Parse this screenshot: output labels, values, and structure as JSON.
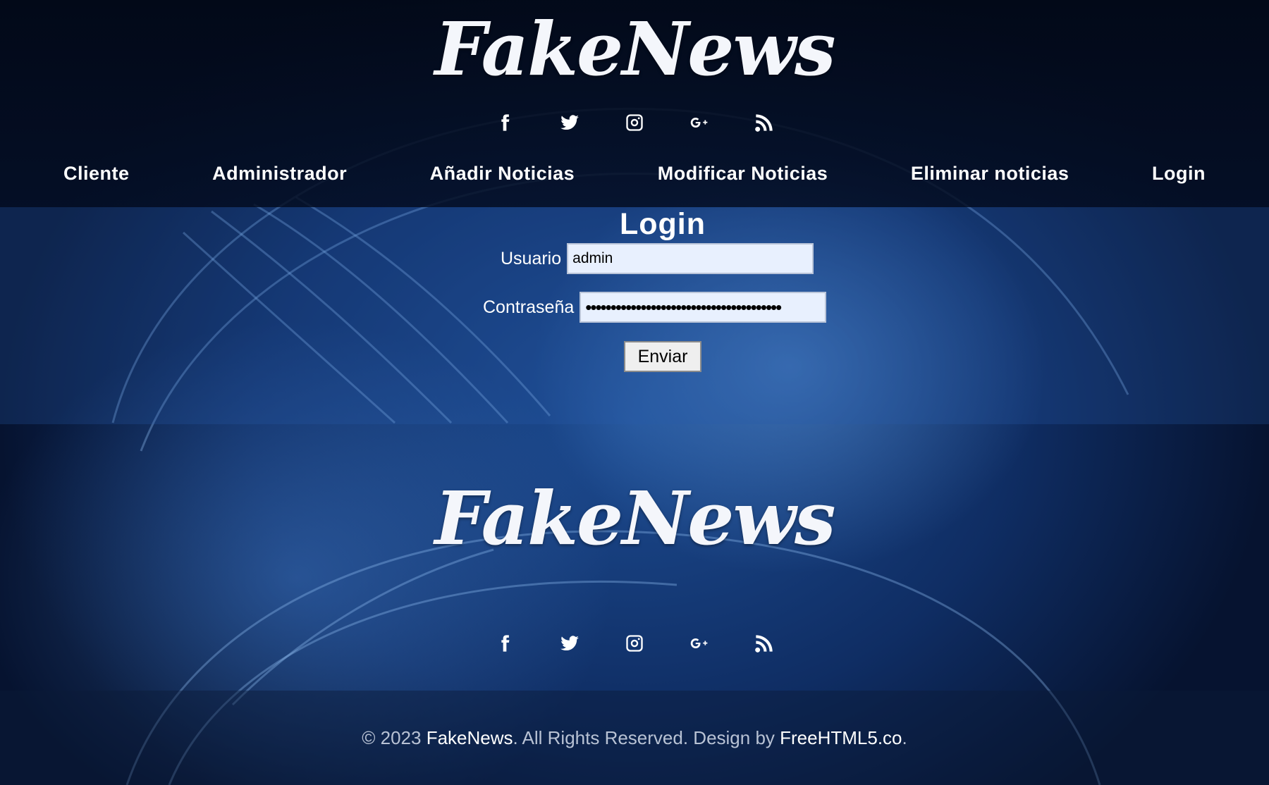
{
  "header": {
    "logo": "FakeNews",
    "social_icons": [
      "facebook-icon",
      "twitter-icon",
      "instagram-icon",
      "google-plus-icon",
      "rss-icon"
    ]
  },
  "nav": {
    "items": [
      {
        "label": "Cliente"
      },
      {
        "label": "Administrador"
      },
      {
        "label": "Añadir Noticias"
      },
      {
        "label": "Modificar Noticias"
      },
      {
        "label": "Eliminar noticias"
      },
      {
        "label": "Login"
      }
    ]
  },
  "login": {
    "title": "Login",
    "user_label": "Usuario",
    "user_value": "admin",
    "password_label": "Contraseña",
    "password_value": "•••••••••••••••••••••••••••••••••••••••",
    "submit_label": "Enviar"
  },
  "footer": {
    "logo": "FakeNews",
    "copyright_prefix": "© 2023 ",
    "brand": "FakeNews",
    "copyright_middle": ". All Rights Reserved. Design by ",
    "designer": "FreeHTML5.co",
    "copyright_suffix": "."
  },
  "colors": {
    "background": "#0f2d63",
    "header_band": "#030a1c",
    "input_bg": "#e8f0fe"
  }
}
